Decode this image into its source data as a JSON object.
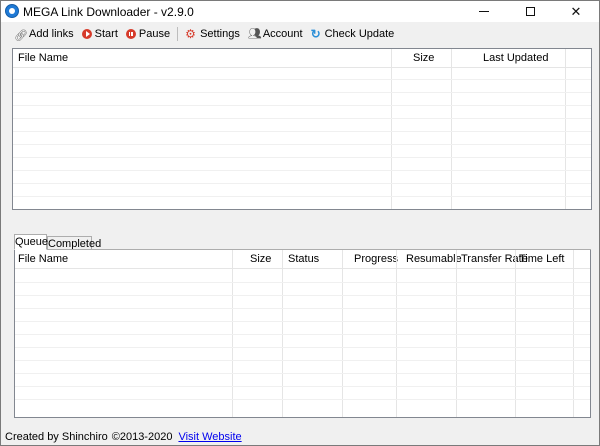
{
  "window": {
    "title": "MEGA Link Downloader - v2.9.0",
    "icon": "app-globe-icon"
  },
  "toolbar": {
    "items": [
      {
        "label": "Add links",
        "icon": "link-icon"
      },
      {
        "label": "Start",
        "icon": "play-icon"
      },
      {
        "label": "Pause",
        "icon": "pause-icon"
      },
      {
        "label": "Settings",
        "icon": "gear-icon"
      },
      {
        "label": "Account",
        "icon": "users-icon"
      },
      {
        "label": "Check Update",
        "icon": "refresh-icon"
      }
    ]
  },
  "links_list": {
    "columns": [
      "File Name",
      "Size",
      "Last Updated"
    ],
    "rows": []
  },
  "tabs": [
    {
      "label": "Queue",
      "active": true
    },
    {
      "label": "Completed",
      "active": false
    }
  ],
  "queue_list": {
    "columns": [
      "File Name",
      "Size",
      "Status",
      "Progress",
      "Resumable",
      "Transfer Rate",
      "Time Left"
    ],
    "rows": []
  },
  "statusbar": {
    "credit": "Created by Shinchiro",
    "copyright": "©2013-2020",
    "link_label": "Visit Website"
  },
  "colors": {
    "accent_red": "#d63a2a",
    "update_blue": "#2b8fd8",
    "link_blue": "#0000ee"
  }
}
